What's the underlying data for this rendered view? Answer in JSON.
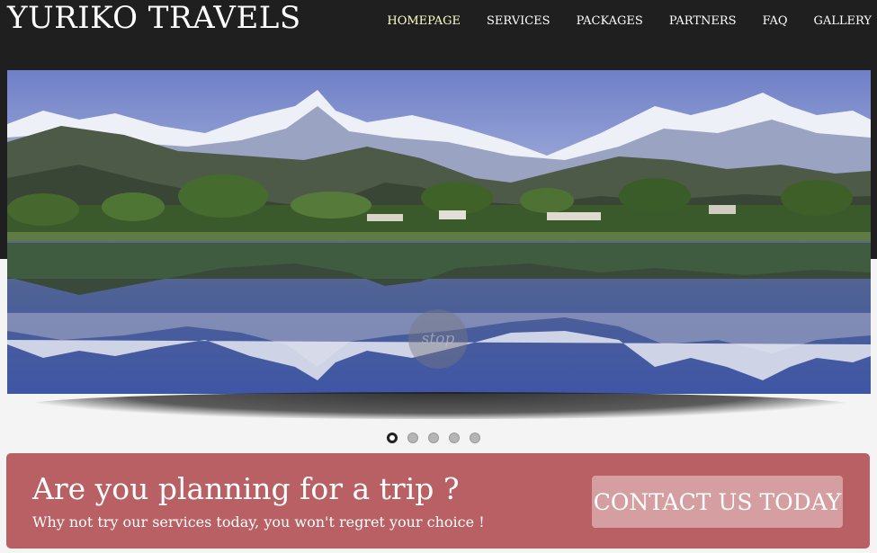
{
  "header": {
    "logo": "YURIKO TRAVELS",
    "nav": [
      {
        "label": "HOMEPAGE",
        "active": true
      },
      {
        "label": "SERVICES"
      },
      {
        "label": "PACKAGES"
      },
      {
        "label": "PARTNERS"
      },
      {
        "label": "FAQ"
      },
      {
        "label": "GALLERY"
      }
    ]
  },
  "slider": {
    "image": "mountain-lake-landscape",
    "stop_label": "stop",
    "slide_count": 5,
    "current_slide": 1
  },
  "cta": {
    "title": "Are you planning for a trip ?",
    "subtitle": "Why not try our services today, you won't regret your choice !",
    "button_label": "CONTACT US TODAY"
  },
  "colors": {
    "header_bg": "#1f1f1f",
    "active_nav": "#ffffcc",
    "cta_bg": "#b86063",
    "cta_button_bg": "#d59fa1"
  }
}
